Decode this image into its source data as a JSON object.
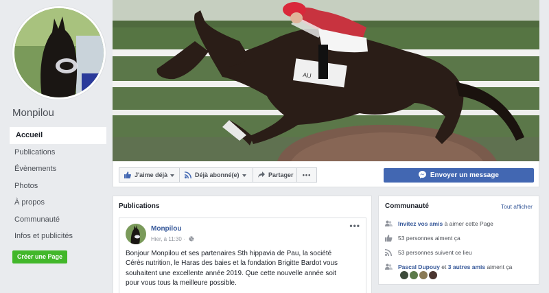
{
  "sidebar": {
    "page_name": "Monpilou",
    "nav": [
      "Accueil",
      "Publications",
      "Évènements",
      "Photos",
      "À propos",
      "Communauté",
      "Infos et publicités"
    ],
    "create_page": "Créer une Page"
  },
  "actions": {
    "like": "J'aime déjà",
    "follow": "Déjà abonné(e)",
    "share": "Partager",
    "more": "•••",
    "message": "Envoyer un message"
  },
  "posts": {
    "title": "Publications",
    "post": {
      "author": "Monpilou",
      "time": "Hier, à 11:30 ·",
      "more": "•••",
      "text": "Bonjour Monpilou et ses partenaires Sth hippavia de Pau, la société Cérès nutrition, le Haras des baies et la fondation Brigitte Bardot vous souhaitent une excellente année 2019. Que cette nouvelle année soit pour vous tous la meilleure possible."
    }
  },
  "community": {
    "title": "Communauté",
    "see_all": "Tout afficher",
    "invite_link": "Invitez vos amis",
    "invite_rest": " à aimer cette Page",
    "likes": "53 personnes aiment ça",
    "follows": "53 personnes suivent ce lieu",
    "friend_name": "Pascal Dupouy",
    "friend_mid": " et ",
    "friend_others": "3 autres amis",
    "friend_rest": " aiment ça"
  },
  "colors": {
    "brand_blue": "#4267b2",
    "link_blue": "#365899",
    "green": "#42b72a",
    "background": "#e9ebee"
  },
  "icons": [
    "thumbs-up-icon",
    "rss-icon",
    "share-arrow-icon",
    "messenger-icon",
    "globe-icon",
    "people-icon",
    "like-icon",
    "follow-icon",
    "friends-icon"
  ]
}
